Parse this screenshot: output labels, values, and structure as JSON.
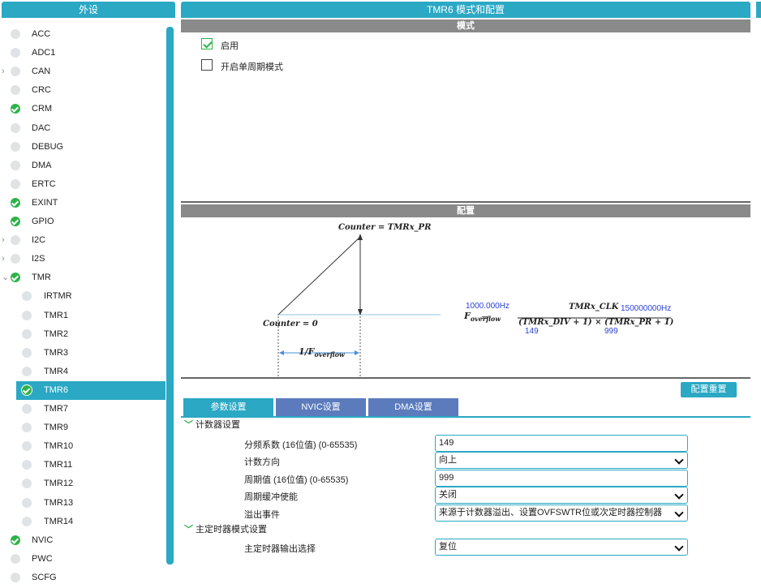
{
  "left_panel": {
    "title": "外设",
    "items": [
      {
        "label": "ACC",
        "status": "none",
        "expandable": false
      },
      {
        "label": "ADC1",
        "status": "none",
        "expandable": false
      },
      {
        "label": "CAN",
        "status": "none",
        "expandable": true
      },
      {
        "label": "CRC",
        "status": "none",
        "expandable": false
      },
      {
        "label": "CRM",
        "status": "ok",
        "expandable": false
      },
      {
        "label": "DAC",
        "status": "none",
        "expandable": false
      },
      {
        "label": "DEBUG",
        "status": "none",
        "expandable": false
      },
      {
        "label": "DMA",
        "status": "none",
        "expandable": false
      },
      {
        "label": "ERTC",
        "status": "none",
        "expandable": false
      },
      {
        "label": "EXINT",
        "status": "ok",
        "expandable": false
      },
      {
        "label": "GPIO",
        "status": "ok",
        "expandable": false
      },
      {
        "label": "I2C",
        "status": "none",
        "expandable": true
      },
      {
        "label": "I2S",
        "status": "none",
        "expandable": true
      },
      {
        "label": "TMR",
        "status": "ok",
        "expandable": true,
        "expanded": true
      },
      {
        "label": "IRTMR",
        "status": "none",
        "child": true
      },
      {
        "label": "TMR1",
        "status": "none",
        "child": true
      },
      {
        "label": "TMR2",
        "status": "none",
        "child": true
      },
      {
        "label": "TMR3",
        "status": "none",
        "child": true
      },
      {
        "label": "TMR4",
        "status": "none",
        "child": true
      },
      {
        "label": "TMR6",
        "status": "ok",
        "child": true,
        "selected": true
      },
      {
        "label": "TMR7",
        "status": "none",
        "child": true
      },
      {
        "label": "TMR9",
        "status": "none",
        "child": true
      },
      {
        "label": "TMR10",
        "status": "none",
        "child": true
      },
      {
        "label": "TMR11",
        "status": "none",
        "child": true
      },
      {
        "label": "TMR12",
        "status": "none",
        "child": true
      },
      {
        "label": "TMR13",
        "status": "none",
        "child": true
      },
      {
        "label": "TMR14",
        "status": "none",
        "child": true
      },
      {
        "label": "NVIC",
        "status": "ok",
        "expandable": false
      },
      {
        "label": "PWC",
        "status": "none",
        "expandable": false
      },
      {
        "label": "SCFG",
        "status": "none",
        "expandable": false
      }
    ]
  },
  "main": {
    "title": "TMR6 模式和配置",
    "mode_section": "模式",
    "enable_label": "启用",
    "enable_checked": true,
    "one_pulse_label": "开启单周期模式",
    "one_pulse_checked": false,
    "config_section": "配置",
    "diagram": {
      "counter_top": "Counter = TMRx_PR",
      "counter_zero": "Counter = 0",
      "period_label": "1/F",
      "period_sub": "overflow",
      "freq_value": "1000.000Hz",
      "f_label": "F",
      "f_sub": "overflow",
      "numerator": "TMRx_CLK",
      "clk_value": "150000000Hz",
      "denominator": "(TMRx_DIV + 1) × (TMRx_PR + 1)",
      "div_value": "149",
      "pr_value": "999"
    },
    "reset_button": "配置重置",
    "tabs": [
      "参数设置",
      "NVIC设置",
      "DMA设置"
    ],
    "groups": [
      {
        "title": "计数器设置",
        "params": [
          {
            "label": "分频系数 (16位值) (0-65535)",
            "value": "149",
            "type": "input"
          },
          {
            "label": "计数方向",
            "value": "向上",
            "type": "select"
          },
          {
            "label": "周期值 (16位值) (0-65535)",
            "value": "999",
            "type": "input"
          },
          {
            "label": "周期缓冲使能",
            "value": "关闭",
            "type": "select"
          },
          {
            "label": "溢出事件",
            "value": "来源于计数器溢出、设置OVFSWTR位或次定时器控制器",
            "type": "select"
          }
        ]
      },
      {
        "title": "主定时器模式设置",
        "params": [
          {
            "label": "主定时器输出选择",
            "value": "复位",
            "type": "select"
          }
        ]
      }
    ]
  },
  "colors": {
    "accent": "#2aa8c4",
    "ok": "#2db24a",
    "tab_inactive": "#5b7bbd",
    "section_bar": "#8a8a8a"
  }
}
